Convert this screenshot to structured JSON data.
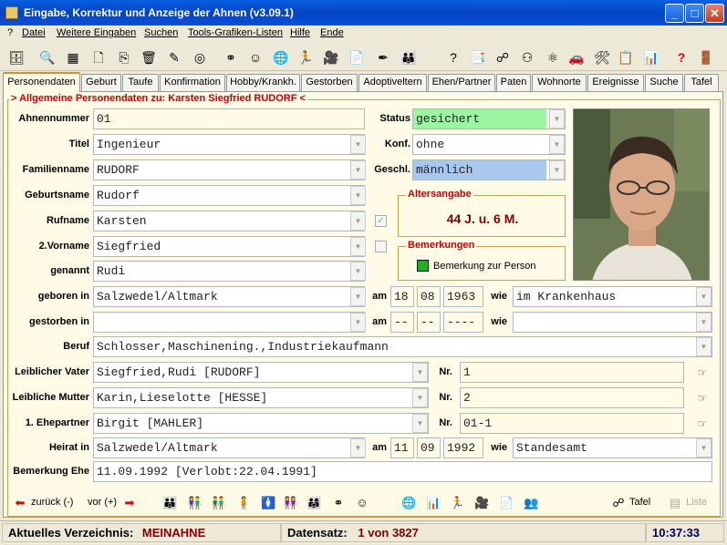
{
  "window": {
    "title": "Eingabe, Korrektur und Anzeige der Ahnen (v3.09.1)"
  },
  "menu": [
    "?",
    "Datei",
    "Weitere Eingaben",
    "Suchen",
    "Tools-Grafiken-Listen",
    "Hilfe",
    "Ende"
  ],
  "tabs": [
    "Personendaten",
    "Geburt",
    "Taufe",
    "Konfirmation",
    "Hobby/Krankh.",
    "Gestorben",
    "Adoptiveltern",
    "Ehen/Partner",
    "Paten",
    "Wohnorte",
    "Ereignisse",
    "Suche",
    "Tafel"
  ],
  "section_title": "> Allgemeine Personendaten zu:  Karsten Siegfried RUDORF <",
  "fields": {
    "ahnennummer": {
      "label": "Ahnennummer",
      "value": "01"
    },
    "titel": {
      "label": "Titel",
      "value": "Ingenieur"
    },
    "familienname": {
      "label": "Familienname",
      "value": "RUDORF"
    },
    "geburtsname": {
      "label": "Geburtsname",
      "value": "Rudorf"
    },
    "rufname": {
      "label": "Rufname",
      "value": "Karsten"
    },
    "vorname2": {
      "label": "2.Vorname",
      "value": "Siegfried"
    },
    "genannt": {
      "label": "genannt",
      "value": "Rudi"
    },
    "geboren": {
      "label": "geboren in",
      "value": "Salzwedel/Altmark",
      "am": "am",
      "day": "18",
      "month": "08",
      "year": "1963",
      "wie": "wie",
      "wie_value": "im Krankenhaus"
    },
    "gestorben": {
      "label": "gestorben in",
      "value": "",
      "am": "am",
      "day": "--",
      "month": "--",
      "year": "----",
      "wie": "wie",
      "wie_value": ""
    },
    "beruf": {
      "label": "Beruf",
      "value": "Schlosser,Maschinening.,Industriekaufmann"
    },
    "vater": {
      "label": "Leiblicher Vater",
      "value": "Siegfried,Rudi [RUDORF]",
      "nr_label": "Nr.",
      "nr": "1"
    },
    "mutter": {
      "label": "Leibliche Mutter",
      "value": "Karin,Lieselotte [HESSE]",
      "nr_label": "Nr.",
      "nr": "2"
    },
    "ehepartner": {
      "label": "1. Ehepartner",
      "value": "Birgit [MAHLER]",
      "nr_label": "Nr.",
      "nr": "01-1"
    },
    "heirat": {
      "label": "Heirat in",
      "value": "Salzwedel/Altmark",
      "am": "am",
      "day": "11",
      "month": "09",
      "year": "1992",
      "wie": "wie",
      "wie_value": "Standesamt"
    },
    "bemerkung_ehe": {
      "label": "Bemerkung Ehe",
      "value": "11.09.1992 [Verlobt:22.04.1991]"
    },
    "status": {
      "label": "Status",
      "value": "gesichert"
    },
    "konf": {
      "label": "Konf.",
      "value": "ohne"
    },
    "geschl": {
      "label": "Geschl.",
      "value": "männlich"
    }
  },
  "altersangabe": {
    "title": "Altersangabe",
    "value": "44 J. u. 6 M."
  },
  "bemerkungen": {
    "title": "Bemerkungen",
    "item": "Bemerkung zur Person"
  },
  "nav": {
    "back": "zurück (-)",
    "forward": "vor (+)",
    "tafel": "Tafel",
    "liste": "Liste"
  },
  "status": {
    "verzeichnis_label": "Aktuelles Verzeichnis:",
    "verzeichnis": "MEINAHNE",
    "datensatz_label": "Datensatz:",
    "datensatz": "1 von 3827",
    "time": "10:37:33"
  },
  "colors": {
    "status_green": "#9cf5a0",
    "geschl_blue": "#a8c8f0",
    "accent_red": "#cc0000"
  }
}
